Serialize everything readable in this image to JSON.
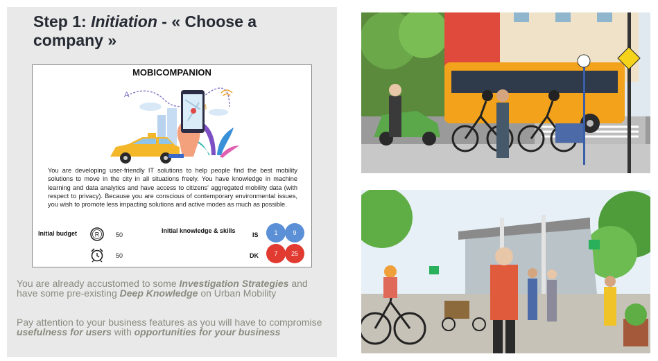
{
  "slide": {
    "title_prefix": "Step 1: ",
    "title_italic": "Initiation",
    "title_suffix": " - « Choose a company »"
  },
  "card": {
    "title": "MOBICOMPANION",
    "description": "You are developing user-friendly IT solutions to help people find the best mobility solutions to move in the city in all situations freely. You have knowledge in machine learning and data analytics and have access to citizens' aggregated mobility data (with respect to privacy). Because you are conscious of contemporary environmental issues, you wish to promote less impacting solutions and active modes as much as possible.",
    "budget_label": "Initial budget",
    "money_value": "50",
    "time_value": "50",
    "knowledge_label": "Initial knowledge & skills",
    "is_label": "IS",
    "is_values": [
      "1",
      "9"
    ],
    "dk_label": "DK",
    "dk_values": [
      "7",
      "25"
    ],
    "money_icon_letter": "R",
    "illustration_letters": [
      "A",
      "B"
    ]
  },
  "notes": {
    "p1_a": "You are already accustomed to some ",
    "p1_b": "Investigation Strategies",
    "p1_c": " and have some pre-existing ",
    "p1_d": "Deep Knowledge",
    "p1_e": " on Urban Mobility",
    "p2_a": "Pay attention to your business features as you will have to compromise ",
    "p2_b": "usefulness for users",
    "p2_c": " with ",
    "p2_d": "opportunities for your business"
  },
  "colors": {
    "panel": "#e9e9e9",
    "title": "#262a33",
    "note_text": "#8a8a80",
    "is_circle": "#5b8fd6",
    "dk_circle": "#e13a30"
  }
}
